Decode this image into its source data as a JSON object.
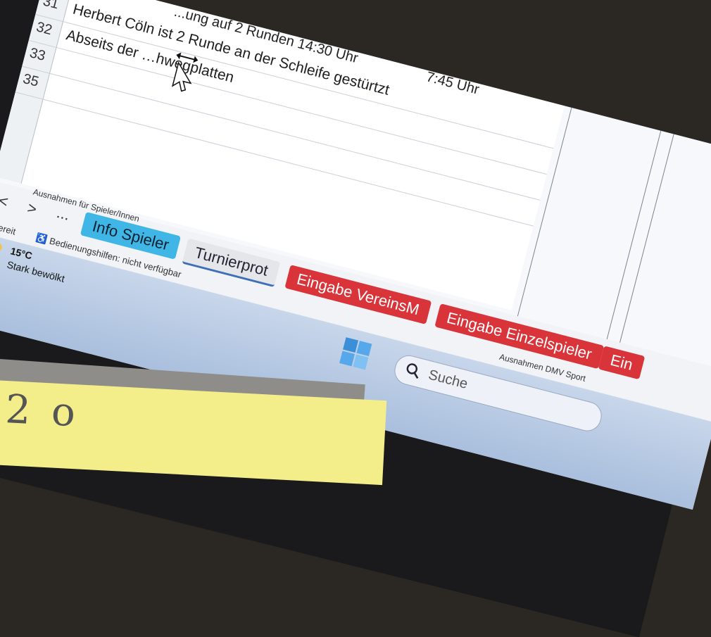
{
  "sheet": {
    "header_fragments": {
      "top_time": "7:45 Uhr",
      "top_line": "...ung auf  2 Runden 14:30 Uhr"
    },
    "rows": [
      {
        "num": "31",
        "text": "Herbert Cöln ist 2 Runde an der Schleife gestürtzt"
      },
      {
        "num": "32",
        "text": "Abseits der …hwegplatten"
      },
      {
        "num": "33",
        "text": ""
      },
      {
        "num": "35",
        "text": ""
      }
    ],
    "right_note": "Ausnahmen DMV Sport",
    "tab_header_note": "Ausnahmen für Spieler/Innen"
  },
  "tabs": {
    "nav_prev": "<",
    "nav_next": ">",
    "nav_more": "...",
    "items": [
      {
        "label": "Info Spieler",
        "style": "cyan"
      },
      {
        "label": "Turnierprot",
        "style": "plain"
      },
      {
        "label": "Eingabe VereinsM",
        "style": "red"
      },
      {
        "label": "Eingabe Einzelspieler",
        "style": "red"
      },
      {
        "label": "Ein",
        "style": "red"
      }
    ]
  },
  "status": {
    "ready": "Bereit",
    "accessibility": "Bedienungshilfen: nicht verfügbar"
  },
  "taskbar": {
    "temperature": "15°C",
    "condition": "Stark bewölkt",
    "search_placeholder": "Suche"
  },
  "colors": {
    "tab_cyan": "#3fb6e6",
    "tab_red": "#d8343a",
    "taskbar": "#b8cbe4"
  }
}
